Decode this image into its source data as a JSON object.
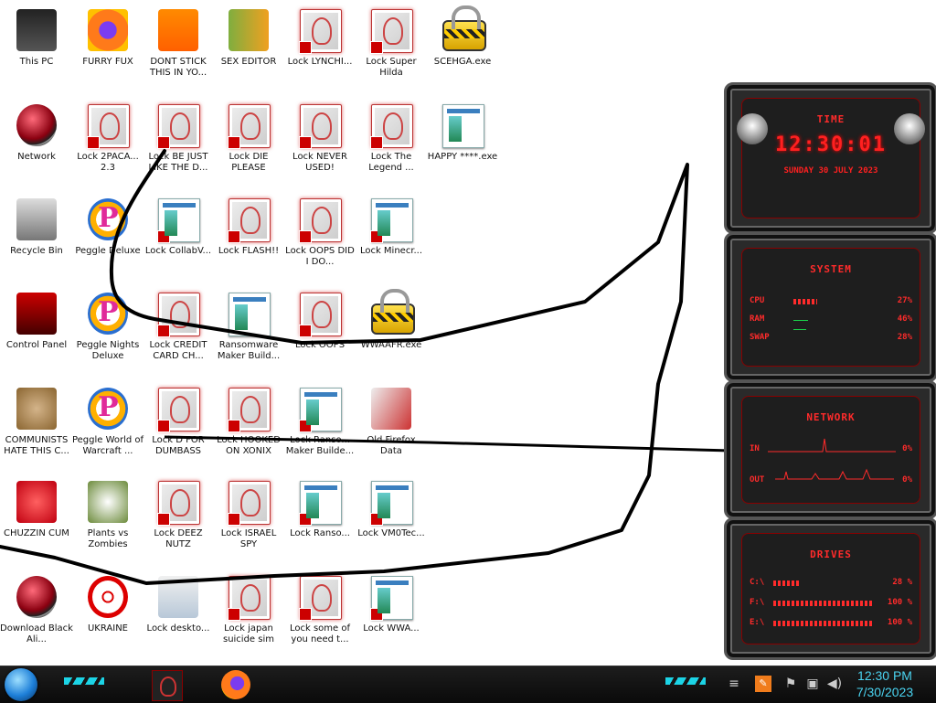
{
  "desktop_icons": [
    {
      "label": "This PC",
      "icon": "monitor-icon"
    },
    {
      "label": "FURRY FUX",
      "icon": "firefox-icon"
    },
    {
      "label": "DONT STICK THIS IN YO...",
      "icon": "vlc-cone-icon"
    },
    {
      "label": "SEX EDITOR",
      "icon": "hxd-hex-editor-icon"
    },
    {
      "label": "Lock LYNCHI...",
      "icon": "locked-document-icon"
    },
    {
      "label": "Lock Super Hilda",
      "icon": "locked-document-icon"
    },
    {
      "label": "SCEHGA.exe",
      "icon": "padlock-icon"
    },
    {
      "label": "Network",
      "icon": "network-globe-icon"
    },
    {
      "label": "Lock 2PACA... 2.3",
      "icon": "locked-document-icon"
    },
    {
      "label": "Lock BE JUST LIKE THE D...",
      "icon": "locked-document-icon"
    },
    {
      "label": "Lock DIE PLEASE",
      "icon": "locked-document-icon"
    },
    {
      "label": "Lock NEVER USED!",
      "icon": "locked-document-icon"
    },
    {
      "label": "Lock The Legend ...",
      "icon": "locked-document-icon"
    },
    {
      "label": "HAPPY ****.exe",
      "icon": "window-app-icon"
    },
    {
      "label": "Recycle Bin",
      "icon": "recycle-bin-icon"
    },
    {
      "label": "Peggle Deluxe",
      "icon": "peggle-icon"
    },
    {
      "label": "Lock CollabV...",
      "icon": "window-app-icon"
    },
    {
      "label": "Lock FLASH!!",
      "icon": "locked-document-icon"
    },
    {
      "label": "Lock OOPS DID I DO...",
      "icon": "locked-document-icon"
    },
    {
      "label": "Lock Minecr...",
      "icon": "window-app-icon"
    },
    {
      "label": "Control Panel",
      "icon": "control-panel-icon"
    },
    {
      "label": "Peggle Nights Deluxe",
      "icon": "peggle-nights-icon"
    },
    {
      "label": "Lock CREDIT CARD CH...",
      "icon": "locked-document-icon"
    },
    {
      "label": "Ransomware Maker Build...",
      "icon": "window-app-icon"
    },
    {
      "label": "Lock OOPS",
      "icon": "locked-document-icon"
    },
    {
      "label": "WWAAFR.exe",
      "icon": "padlock-icon"
    },
    {
      "label": "COMMUNISTS HATE THIS C...",
      "icon": "money-bag-icon"
    },
    {
      "label": "Peggle World of Warcraft ...",
      "icon": "peggle-icon"
    },
    {
      "label": "Lock D FOR DUMBASS",
      "icon": "locked-document-icon"
    },
    {
      "label": "Lock HOOKED ON XONIX",
      "icon": "locked-document-icon"
    },
    {
      "label": "Lock Ranso... Maker Builde...",
      "icon": "window-app-icon"
    },
    {
      "label": "Old Firefox Data",
      "icon": "folder-data-icon"
    },
    {
      "label": "CHUZZIN CUM",
      "icon": "chuzzle-icon"
    },
    {
      "label": "Plants vs Zombies",
      "icon": "plants-vs-zombies-icon"
    },
    {
      "label": "Lock DEEZ NUTZ",
      "icon": "locked-document-icon"
    },
    {
      "label": "Lock ISRAEL SPY",
      "icon": "locked-document-icon"
    },
    {
      "label": "Lock Ranso...",
      "icon": "window-app-icon"
    },
    {
      "label": "Lock VM0Tec...",
      "icon": "window-app-icon"
    },
    {
      "label": "Download Black Ali...",
      "icon": "network-globe-icon"
    },
    {
      "label": "UKRAINE",
      "icon": "radiation-icon"
    },
    {
      "label": "Lock deskto...",
      "icon": "settings-file-icon"
    },
    {
      "label": "Lock japan suicide sim",
      "icon": "locked-document-icon"
    },
    {
      "label": "Lock some of you need t...",
      "icon": "locked-document-icon"
    },
    {
      "label": "Lock WWA...",
      "icon": "window-app-icon"
    }
  ],
  "widgets": {
    "time": {
      "title": "TIME",
      "clock": "12:30:01",
      "date": "SUNDAY 30 JULY 2023"
    },
    "system": {
      "title": "SYSTEM",
      "rows": [
        {
          "label": "CPU",
          "value": "27%",
          "level": 0.27
        },
        {
          "label": "RAM",
          "value": "46%",
          "level": 0.46
        },
        {
          "label": "SWAP",
          "value": "28%",
          "level": 0.28
        }
      ]
    },
    "network": {
      "title": "NETWORK",
      "rows": [
        {
          "label": "IN",
          "value": "0%"
        },
        {
          "label": "OUT",
          "value": "0%"
        }
      ]
    },
    "drives": {
      "title": "DRIVES",
      "rows": [
        {
          "label": "C:\\",
          "value": "28 %",
          "level": 0.28
        },
        {
          "label": "F:\\",
          "value": "100 %",
          "level": 1.0
        },
        {
          "label": "E:\\",
          "value": "100 %",
          "level": 1.0
        }
      ]
    }
  },
  "taskbar": {
    "time": "12:30 PM",
    "date": "7/30/2023",
    "pinned": [
      {
        "name": "alien-app-icon"
      },
      {
        "name": "firefox-icon"
      }
    ],
    "tray": [
      "show-hidden-icons-chevron",
      "language-icon",
      "flag-icon",
      "network-icon",
      "volume-icon"
    ]
  },
  "colors": {
    "widget_red": "#ff2b2b",
    "clock_cyan": "#4ad3f0",
    "taskbar_bg": "#111111"
  }
}
